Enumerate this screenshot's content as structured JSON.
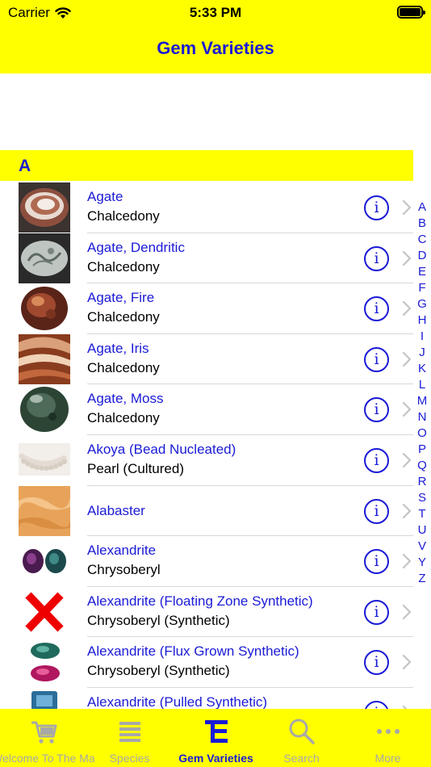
{
  "status_bar": {
    "carrier": "Carrier",
    "time": "5:33 PM"
  },
  "nav": {
    "title": "Gem Varieties"
  },
  "section": {
    "letter": "A"
  },
  "rows": [
    {
      "title": "Agate",
      "subtitle": "Chalcedony",
      "icon": "agate-thumbnail"
    },
    {
      "title": "Agate, Dendritic",
      "subtitle": "Chalcedony",
      "icon": "agate-dendritic-thumbnail"
    },
    {
      "title": "Agate, Fire",
      "subtitle": "Chalcedony",
      "icon": "agate-fire-thumbnail"
    },
    {
      "title": "Agate, Iris",
      "subtitle": "Chalcedony",
      "icon": "agate-iris-thumbnail"
    },
    {
      "title": "Agate, Moss",
      "subtitle": "Chalcedony",
      "icon": "agate-moss-thumbnail"
    },
    {
      "title": "Akoya (Bead Nucleated)",
      "subtitle": "Pearl (Cultured)",
      "icon": "pearl-necklace-thumbnail"
    },
    {
      "title": "Alabaster",
      "subtitle": "",
      "icon": "alabaster-thumbnail"
    },
    {
      "title": "Alexandrite",
      "subtitle": "Chrysoberyl",
      "icon": "alexandrite-thumbnail"
    },
    {
      "title": "Alexandrite (Floating Zone Synthetic)",
      "subtitle": "Chrysoberyl (Synthetic)",
      "icon": "no-image-x-icon"
    },
    {
      "title": "Alexandrite (Flux Grown Synthetic)",
      "subtitle": "Chrysoberyl (Synthetic)",
      "icon": "alexandrite-flux-thumbnail"
    },
    {
      "title": "Alexandrite (Pulled Synthetic)",
      "subtitle": "",
      "icon": "alexandrite-pulled-thumbnail"
    }
  ],
  "info_glyph": "i",
  "index_letters": [
    "A",
    "B",
    "C",
    "D",
    "E",
    "F",
    "G",
    "H",
    "I",
    "J",
    "K",
    "L",
    "M",
    "N",
    "O",
    "P",
    "Q",
    "R",
    "S",
    "T",
    "U",
    "V",
    "Y",
    "Z"
  ],
  "tabs": [
    {
      "label": "Welcome To The Market",
      "icon": "cart-icon",
      "active": false
    },
    {
      "label": "Species",
      "icon": "list-icon",
      "active": false
    },
    {
      "label": "Gem Varieties",
      "icon": "gem-varieties-icon",
      "active": true
    },
    {
      "label": "Search",
      "icon": "search-icon",
      "active": false
    },
    {
      "label": "More",
      "icon": "more-icon",
      "active": false
    }
  ],
  "colors": {
    "accent": "#1a1ad6",
    "bar_background": "#ffff00",
    "inactive_tab": "#a8a8a8"
  }
}
